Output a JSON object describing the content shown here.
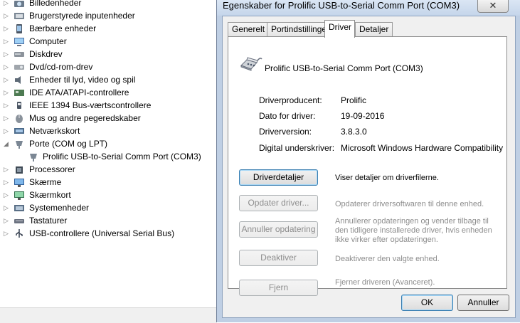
{
  "tree": {
    "items": [
      {
        "label": "Billedenheder",
        "icon": "camera-icon",
        "expanded": false
      },
      {
        "label": "Brugerstyrede inputenheder",
        "icon": "hid-icon",
        "expanded": false
      },
      {
        "label": "Bærbare enheder",
        "icon": "portable-device-icon",
        "expanded": false
      },
      {
        "label": "Computer",
        "icon": "computer-icon",
        "expanded": false
      },
      {
        "label": "Diskdrev",
        "icon": "disk-drive-icon",
        "expanded": false
      },
      {
        "label": "Dvd/cd-rom-drev",
        "icon": "dvd-drive-icon",
        "expanded": false
      },
      {
        "label": "Enheder til lyd, video og spil",
        "icon": "speaker-icon",
        "expanded": false
      },
      {
        "label": "IDE ATA/ATAPI-controllere",
        "icon": "ide-controller-icon",
        "expanded": false
      },
      {
        "label": "IEEE 1394 Bus-værtscontrollere",
        "icon": "firewire-icon",
        "expanded": false
      },
      {
        "label": "Mus og andre pegeredskaber",
        "icon": "mouse-icon",
        "expanded": false
      },
      {
        "label": "Netværkskort",
        "icon": "network-adapter-icon",
        "expanded": false
      },
      {
        "label": "Porte (COM og LPT)",
        "icon": "port-icon",
        "expanded": true
      },
      {
        "label": "Prolific USB-to-Serial Comm Port (COM3)",
        "icon": "serial-port-icon",
        "child": true
      },
      {
        "label": "Processorer",
        "icon": "processor-icon",
        "expanded": false
      },
      {
        "label": "Skærme",
        "icon": "monitor-icon",
        "expanded": false
      },
      {
        "label": "Skærmkort",
        "icon": "display-adapter-icon",
        "expanded": false
      },
      {
        "label": "Systemenheder",
        "icon": "system-device-icon",
        "expanded": false
      },
      {
        "label": "Tastaturer",
        "icon": "keyboard-icon",
        "expanded": false
      },
      {
        "label": "USB-controllere (Universal Serial Bus)",
        "icon": "usb-icon",
        "expanded": false
      }
    ]
  },
  "dialog": {
    "title": "Egenskaber for Prolific USB-to-Serial Comm Port (COM3)",
    "close_glyph": "✕",
    "tabs": [
      {
        "label": "Generelt",
        "active": false
      },
      {
        "label": "Portindstillinger",
        "active": false
      },
      {
        "label": "Driver",
        "active": true
      },
      {
        "label": "Detaljer",
        "active": false
      }
    ],
    "device_name": "Prolific USB-to-Serial Comm Port (COM3)",
    "info": {
      "provider_label": "Driverproducent:",
      "provider_value": "Prolific",
      "date_label": "Dato for driver:",
      "date_value": "19-09-2016",
      "version_label": "Driverversion:",
      "version_value": "3.8.3.0",
      "signer_label": "Digital underskriver:",
      "signer_value": "Microsoft Windows Hardware Compatibility"
    },
    "actions": {
      "details_label": "Driverdetaljer",
      "details_desc": "Viser detaljer om driverfilerne.",
      "update_label": "Opdater driver...",
      "update_desc": "Opdaterer driversoftwaren til denne enhed.",
      "rollback_label": "Annuller opdatering",
      "rollback_desc": "Annullerer opdateringen og vender tilbage til den tidligere installerede driver, hvis enheden ikke virker efter opdateringen.",
      "disable_label": "Deaktiver",
      "disable_desc": "Deaktiverer den valgte enhed.",
      "uninstall_label": "Fjern",
      "uninstall_desc": "Fjerner driveren (Avanceret)."
    },
    "ok_label": "OK",
    "cancel_label": "Annuller"
  },
  "colors": {
    "dialog_frame": "#bfcfe4",
    "disabled_text": "#8d8d8d",
    "focus_border": "#3c7fb1"
  }
}
